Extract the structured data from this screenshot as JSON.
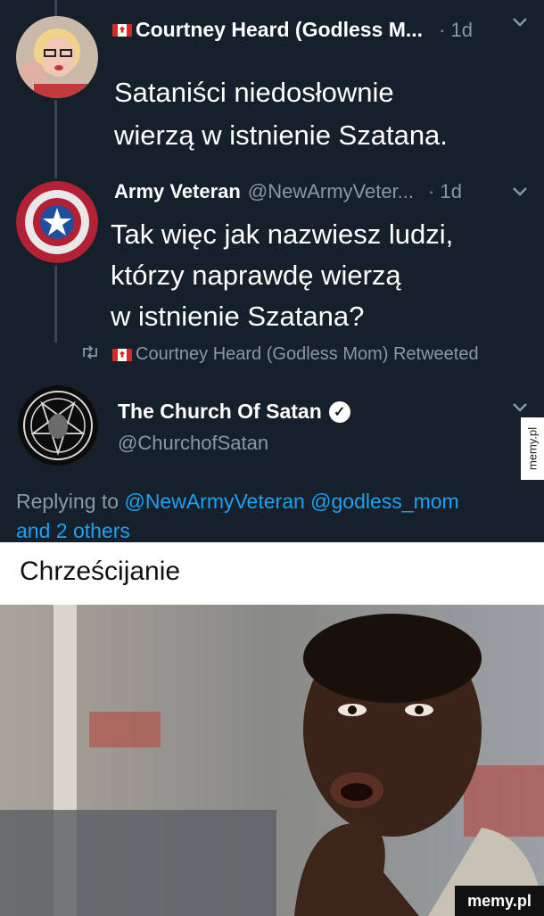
{
  "tweet1": {
    "name": "Courtney Heard (Godless M...",
    "time": "· 1d",
    "text_line1": "Sataniści niedosłownie",
    "text_line2": "wierzą w istnienie Szatana."
  },
  "tweet2": {
    "name": "Army Veteran",
    "handle": "@NewArmyVeter...",
    "time": "· 1d",
    "text_line1": "Tak więc jak nazwiesz ludzi,",
    "text_line2": "którzy naprawdę wierzą",
    "text_line3": "w istnienie Szatana?"
  },
  "retweet": {
    "label": "Courtney Heard (Godless Mom) Retweeted"
  },
  "tweet3": {
    "name": "The Church Of Satan",
    "handle": "@ChurchofSatan",
    "replying_prefix": "Replying to",
    "mention1": "@NewArmyVeteran",
    "mention2": "@godless_mom",
    "others": "and 2 others"
  },
  "caption": "Chrześcijanie",
  "watermarks": {
    "side": "memy.pl",
    "bottom": "memy.pl"
  },
  "icons": {
    "chevron": "chevron-down-icon",
    "retweet": "retweet-icon",
    "verified": "verified-icon"
  }
}
